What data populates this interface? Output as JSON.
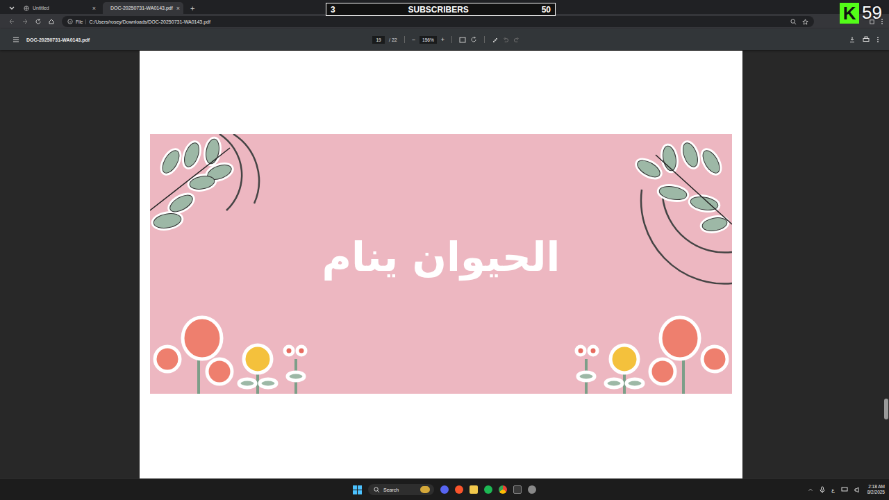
{
  "browser": {
    "tabs": [
      {
        "label": "Untitled",
        "selected": false,
        "close": "×"
      },
      {
        "label": "DOC-20250731-WA0143.pdf",
        "selected": true,
        "close": "×"
      }
    ],
    "new_tab": "+",
    "address": {
      "chip": "File",
      "url": "C:/Users/rosey/Downloads/DOC-20250731-WA0143.pdf"
    }
  },
  "overlay": {
    "left": "3",
    "label": "SUBSCRIBERS",
    "right": "50",
    "logo": "K",
    "count": "59"
  },
  "pdf_toolbar": {
    "filename": "DOC-20250731-WA0143.pdf",
    "page": "19",
    "total": "/ 22",
    "minus": "−",
    "zoom": "156%",
    "plus": "+"
  },
  "page": {
    "title": "الحيوان ينام"
  },
  "scrollbar": {
    "level": 0.86
  },
  "taskbar": {
    "search": "Search",
    "ime": "ع",
    "time": "2:18 AM",
    "date": "8/2/2025"
  }
}
